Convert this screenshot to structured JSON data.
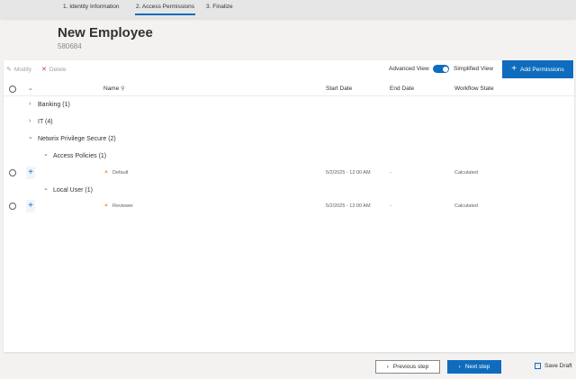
{
  "stepper": {
    "steps": [
      {
        "label": "1. Identity Information"
      },
      {
        "label": "2. Access Permissions"
      },
      {
        "label": "3. Finalize"
      }
    ],
    "active_index": 1
  },
  "header": {
    "title": "New Employee",
    "subtitle": "580684"
  },
  "toolbar": {
    "modify_label": "Modify",
    "delete_label": "Delete",
    "advanced_view_label": "Advanced View",
    "simplified_view_label": "Simplified View",
    "toggle_on": true,
    "add_permissions_label": "Add Permissions"
  },
  "table": {
    "columns": {
      "name": "Name",
      "start_date": "Start Date",
      "end_date": "End Date",
      "workflow_state": "Workflow State"
    },
    "groups": [
      {
        "label": "Banking (1)",
        "expanded": false
      },
      {
        "label": "IT (4)",
        "expanded": false
      },
      {
        "label": "Netwrix Privilege Secure (2)",
        "expanded": true
      }
    ],
    "subgroups": [
      {
        "label": "Access Policies (1)",
        "expanded": true
      },
      {
        "label": "Local User (1)",
        "expanded": true
      }
    ],
    "rows": [
      {
        "name": "Default",
        "start_date": "5/2/2025  - 12:00 AM",
        "end_date": "-",
        "workflow_state": "Calculated"
      },
      {
        "name": "Reviewer",
        "start_date": "5/2/2025  - 12:00 AM",
        "end_date": "-",
        "workflow_state": "Calculated"
      }
    ]
  },
  "footer": {
    "previous_label": "Previous step",
    "next_label": "Next step",
    "save_draft_label": "Save Draft"
  },
  "colors": {
    "accent": "#0f6cbd",
    "warning": "#f7a35c"
  }
}
